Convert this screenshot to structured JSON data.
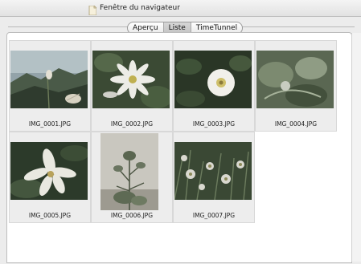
{
  "window": {
    "title": "Fenêtre du navigateur"
  },
  "view_tabs": [
    "Aperçu",
    "Liste",
    "TimeTunnel"
  ],
  "selected_view": "Liste",
  "thumbnails": [
    {
      "filename": "IMG_0001.JPG",
      "orientation": "landscape"
    },
    {
      "filename": "IMG_0002.JPG",
      "orientation": "landscape"
    },
    {
      "filename": "IMG_0003.JPG",
      "orientation": "landscape"
    },
    {
      "filename": "IMG_0004.JPG",
      "orientation": "landscape"
    },
    {
      "filename": "IMG_0005.JPG",
      "orientation": "landscape"
    },
    {
      "filename": "IMG_0006.JPG",
      "orientation": "portrait"
    },
    {
      "filename": "IMG_0007.JPG",
      "orientation": "landscape"
    }
  ],
  "colors": {
    "window_bg": "#ececec",
    "panel_bg": "#ffffff",
    "cell_bg": "#ededed"
  }
}
